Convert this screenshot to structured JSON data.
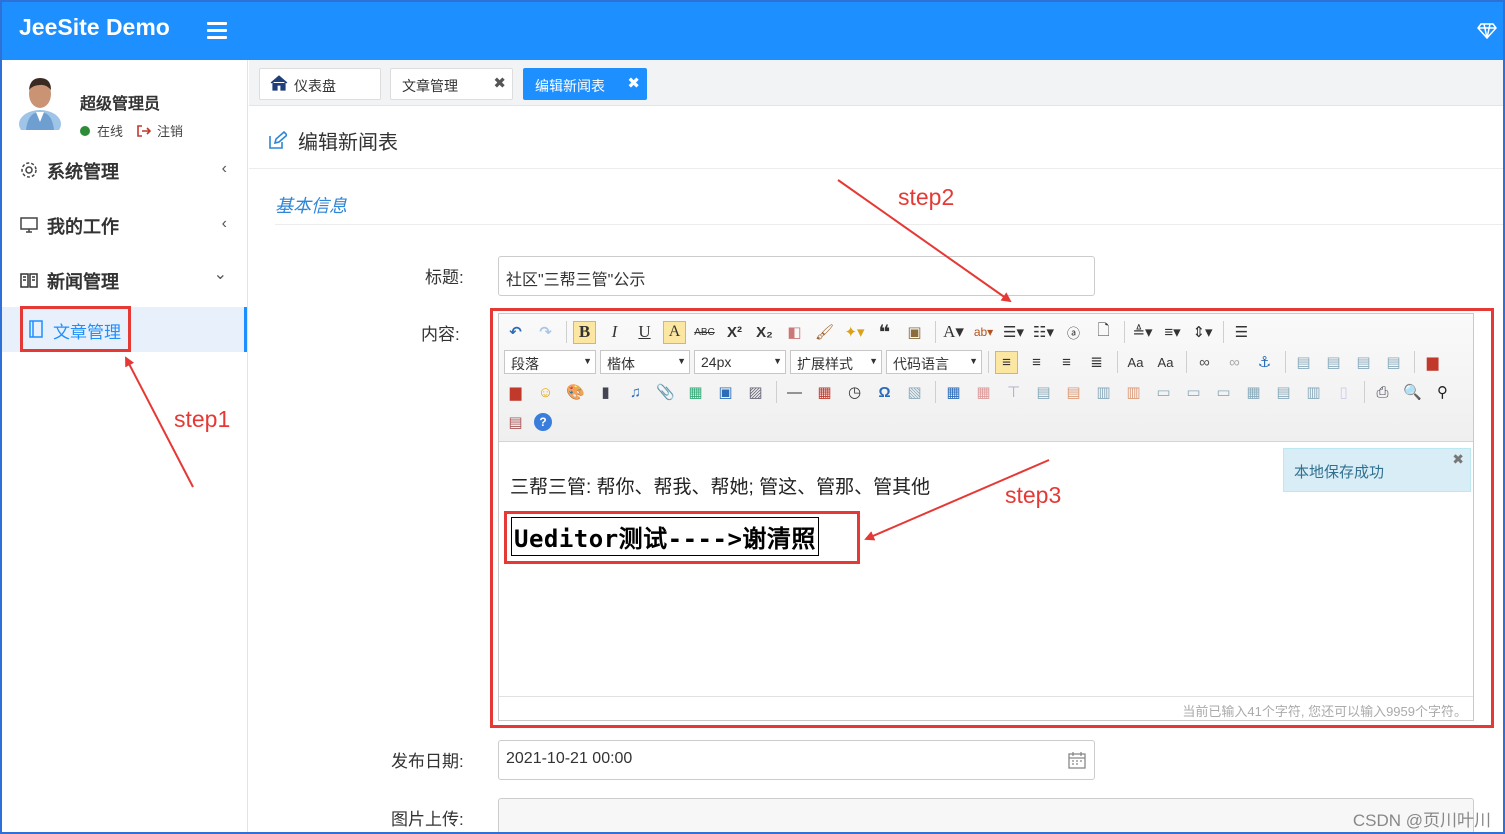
{
  "header": {
    "brand": "JeeSite Demo"
  },
  "user": {
    "name": "超级管理员",
    "status": "在线",
    "logout": "注销"
  },
  "sidebar": {
    "menus": [
      {
        "label": "系统管理",
        "arrow": "‹"
      },
      {
        "label": "我的工作",
        "arrow": "‹"
      },
      {
        "label": "新闻管理",
        "arrow": "⌄"
      }
    ],
    "active_sub": "文章管理"
  },
  "tabs": [
    {
      "label": "仪表盘"
    },
    {
      "label": "文章管理",
      "close": "✖"
    },
    {
      "label": "编辑新闻表",
      "close": "✖"
    }
  ],
  "page": {
    "title": "编辑新闻表",
    "section": "基本信息"
  },
  "form": {
    "title_label": "标题:",
    "title_value": "社区\"三帮三管\"公示",
    "content_label": "内容:",
    "date_label": "发布日期:",
    "date_value": "2021-10-21 00:00",
    "image_label": "图片上传:"
  },
  "editor": {
    "dropdowns": {
      "paragraph": "段落",
      "font": "楷体",
      "size": "24px",
      "ext": "扩展样式",
      "code": "代码语言"
    },
    "content_line1": "三帮三管: 帮你、帮我、帮她; 管这、管那、管其他",
    "content_line2": "Ueditor测试---->谢清照",
    "toast": "本地保存成功",
    "toast_close": "✖",
    "wordcount": "当前已输入41个字符, 您还可以输入9959个字符。"
  },
  "annotations": {
    "step1": "step1",
    "step2": "step2",
    "step3": "step3"
  },
  "watermark": "CSDN @页川叶川",
  "colors": {
    "primary": "#1e8fff",
    "annotation": "#e53935",
    "toast_bg": "#d9edf7"
  }
}
